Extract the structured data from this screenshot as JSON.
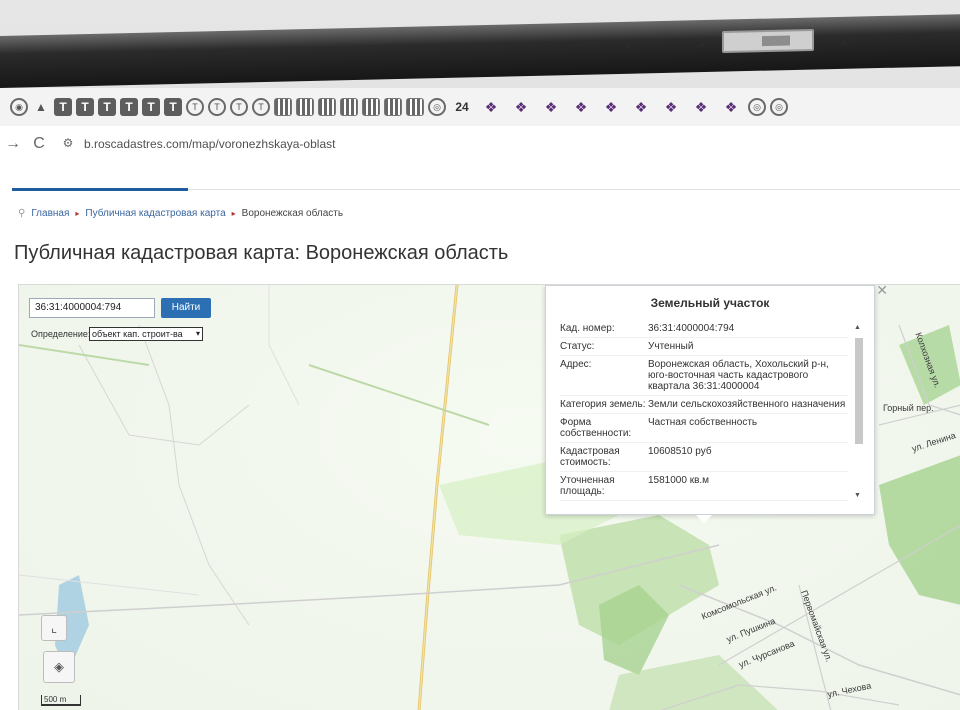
{
  "bookmarks_bar": {
    "items": [
      {
        "kind": "circ",
        "glyph": "◉"
      },
      {
        "kind": "plain",
        "glyph": "▲"
      },
      {
        "kind": "sq",
        "glyph": "T"
      },
      {
        "kind": "sq",
        "glyph": "T"
      },
      {
        "kind": "sq",
        "glyph": "T"
      },
      {
        "kind": "sq",
        "glyph": "T"
      },
      {
        "kind": "sq",
        "glyph": "T"
      },
      {
        "kind": "sq",
        "glyph": "T"
      },
      {
        "kind": "circ",
        "glyph": "T"
      },
      {
        "kind": "circ",
        "glyph": "T"
      },
      {
        "kind": "circ",
        "glyph": "T"
      },
      {
        "kind": "circ",
        "glyph": "T"
      },
      {
        "kind": "grid",
        "glyph": ""
      },
      {
        "kind": "grid",
        "glyph": ""
      },
      {
        "kind": "grid",
        "glyph": ""
      },
      {
        "kind": "grid",
        "glyph": ""
      },
      {
        "kind": "grid",
        "glyph": ""
      },
      {
        "kind": "grid",
        "glyph": ""
      },
      {
        "kind": "grid",
        "glyph": ""
      },
      {
        "kind": "circ",
        "glyph": "◎"
      },
      {
        "kind": "txt",
        "glyph": "24"
      },
      {
        "kind": "cluster",
        "glyph": "❖"
      },
      {
        "kind": "cluster",
        "glyph": "❖"
      },
      {
        "kind": "cluster",
        "glyph": "❖"
      },
      {
        "kind": "cluster",
        "glyph": "❖"
      },
      {
        "kind": "cluster",
        "glyph": "❖"
      },
      {
        "kind": "cluster",
        "glyph": "❖"
      },
      {
        "kind": "cluster",
        "glyph": "❖"
      },
      {
        "kind": "cluster",
        "glyph": "❖"
      },
      {
        "kind": "cluster",
        "glyph": "❖"
      },
      {
        "kind": "circ",
        "glyph": "◎"
      },
      {
        "kind": "circ",
        "glyph": "◎"
      }
    ]
  },
  "browser": {
    "url": "b.roscadastres.com/map/voronezhskaya-oblast",
    "back_glyph": "→",
    "reload_glyph": "C",
    "site_icon_glyph": "⚙"
  },
  "breadcrumb": {
    "items": [
      "Главная",
      "Публичная кадастровая карта"
    ],
    "current": "Воронежская область"
  },
  "page_title": "Публичная кадастровая карта: Воронежская область",
  "map": {
    "search_value": "36:31:4000004:794",
    "search_button": "Найти",
    "definition_label": "Определение:",
    "definition_value": "объект кап. строит-ва",
    "scale_label": "500 m",
    "road_labels": {
      "komsomolskaya": "Комсомольская ул.",
      "pushkina": "ул. Пушкина",
      "chursanova": "ул. Чурсанова",
      "pervomaiskaya": "Первомайская ул.",
      "chekhova": "ул. Чехова",
      "gorny": "Горный пер.",
      "lenina": "ул. Ленина",
      "kolkhoznaya": "Колхозная ул."
    }
  },
  "popup": {
    "title": "Земельный участок",
    "rows": [
      {
        "key": "Кад. номер:",
        "value": "36:31:4000004:794"
      },
      {
        "key": "Статус:",
        "value": "Учтенный"
      },
      {
        "key": "Адрес:",
        "value": "Воронежская область, Хохольский р-н, юго-восточная часть кадастрового квартала 36:31:4000004"
      },
      {
        "key": "Категория земель:",
        "value": "Земли сельскохозяйственного назначения"
      },
      {
        "key": "Форма собственности:",
        "value": "Частная собственность"
      },
      {
        "key": "Кадастровая стоимость:",
        "value": "10608510 руб"
      },
      {
        "key": "Уточненная площадь:",
        "value": "1581000 кв.м"
      }
    ]
  }
}
